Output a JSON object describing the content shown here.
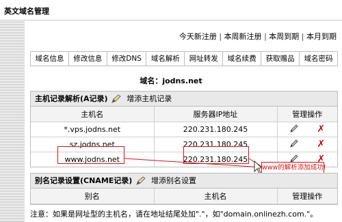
{
  "window": {
    "title": "英文域名管理"
  },
  "quick_links": [
    "今天新注册",
    "本周新注册",
    "本周到期",
    "本月到期"
  ],
  "quick_links_separator": "|",
  "tabs": [
    "域名信息",
    "修改信息",
    "修改DNS",
    "域名解析",
    "网址转发",
    "域名续费",
    "获取赠品",
    "域名密码"
  ],
  "domain_line": "域名：jodns.net",
  "a_records": {
    "title": "主机记录解析(A记录)",
    "add_label": "增添主机记录",
    "columns": [
      "主机名",
      "服务器IP地址",
      "管理操作"
    ],
    "rows": [
      {
        "host": "*.vps.jodns.net",
        "ip": "220.231.180.245"
      },
      {
        "host": "sz.jodns.net",
        "ip": "220.231.180.245"
      },
      {
        "host": "www.jodns.net",
        "ip": "220.231.180.245"
      }
    ]
  },
  "cname_records": {
    "title": "别名记录设置(CNAME记录)",
    "add_label": "增添别名设置",
    "columns": [
      "别名",
      "主机名",
      "管理操作"
    ]
  },
  "callout": "www的解析添加成功!",
  "note": "注意：如果是网址型的主机名，请在地址结尾处加\".\"，如\"domain.onlinezh.com.\"。",
  "colors": {
    "highlight": "#e01010",
    "delete_icon": "#d40000",
    "header_bg": "#e9e9e9"
  },
  "icons": {
    "edit": "pencil-icon",
    "delete": "x-icon",
    "add": "pen-icon"
  }
}
